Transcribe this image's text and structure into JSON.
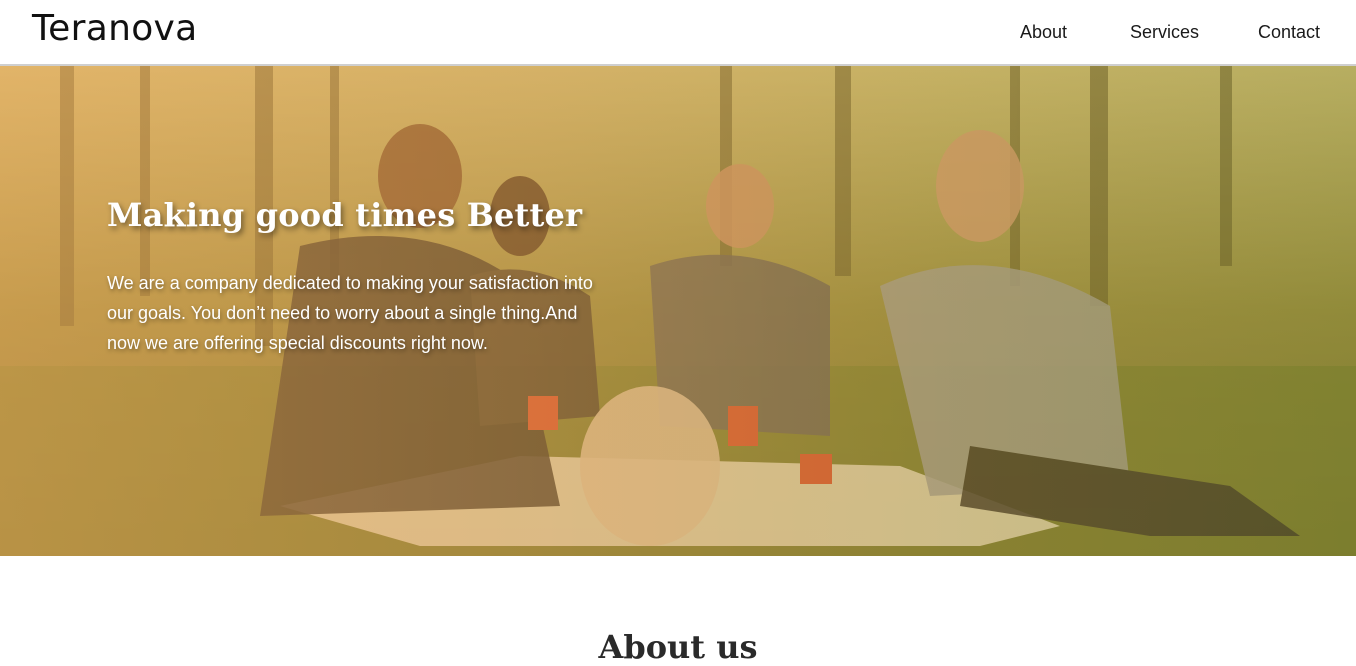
{
  "brand": {
    "name": "Teranova"
  },
  "nav": {
    "items": [
      {
        "label": "About"
      },
      {
        "label": "Services"
      },
      {
        "label": "Contact"
      }
    ]
  },
  "hero": {
    "title": "Making good times Better",
    "text": "We are a company dedicated to making your satisfaction into our goals. You don’t need to worry about a single thing.And now we are offering special discounts right now.",
    "overlay_color": "#f0a556"
  },
  "about": {
    "title": "About us"
  }
}
